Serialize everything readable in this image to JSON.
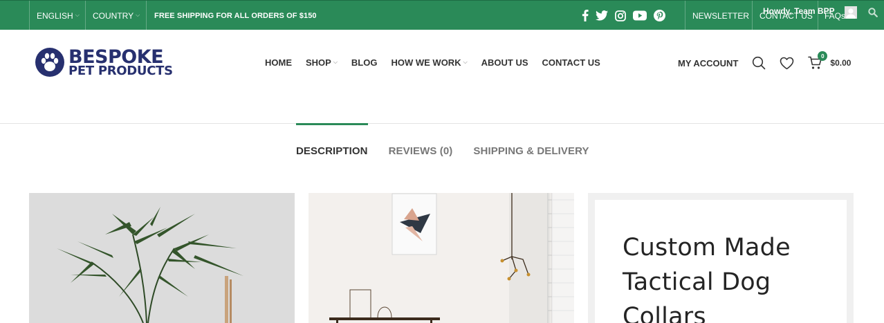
{
  "topbar": {
    "language": "ENGLISH",
    "country": "COUNTRY",
    "shipping_notice": "FREE SHIPPING FOR ALL ORDERS OF $150",
    "social": [
      "facebook-icon",
      "twitter-icon",
      "instagram-icon",
      "youtube-icon",
      "pinterest-icon"
    ],
    "links": [
      "NEWSLETTER",
      "CONTACT US",
      "FAQs"
    ],
    "admin_greeting": "Howdy, Team BPP",
    "bg_color": "#2a8a58"
  },
  "header": {
    "logo_line1": "BESPOKE",
    "logo_line2": "PET PRODUCTS",
    "nav": [
      {
        "label": "HOME",
        "dropdown": false
      },
      {
        "label": "SHOP",
        "dropdown": true
      },
      {
        "label": "BLOG",
        "dropdown": false
      },
      {
        "label": "HOW WE WORK",
        "dropdown": true
      },
      {
        "label": "ABOUT US",
        "dropdown": false
      },
      {
        "label": "CONTACT US",
        "dropdown": false
      }
    ],
    "account": "MY ACCOUNT",
    "cart_count": "0",
    "cart_total": "$0.00"
  },
  "tabs": [
    {
      "label": "DESCRIPTION",
      "active": true
    },
    {
      "label": "REVIEWS (0)",
      "active": false
    },
    {
      "label": "SHIPPING & DELIVERY",
      "active": false
    }
  ],
  "product": {
    "title": "Custom Made Tactical Dog Collars"
  },
  "colors": {
    "accent": "#2a8a58",
    "brand_navy": "#27306f"
  }
}
